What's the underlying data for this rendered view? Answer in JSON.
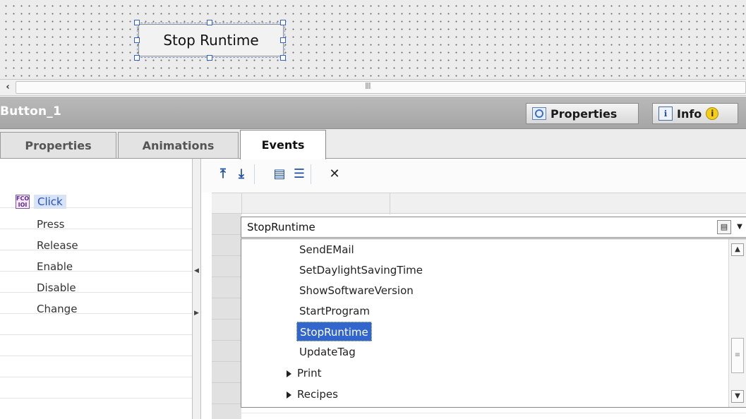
{
  "canvas": {
    "button_label": "Stop Runtime"
  },
  "hscroll": {
    "left_arrow": "‹",
    "grip": "III"
  },
  "inspector": {
    "title": "Button_1",
    "tabs": [
      {
        "label": "Properties",
        "icon": "properties-icon"
      },
      {
        "label": "Info",
        "icon": "info-icon",
        "badge": "i"
      }
    ]
  },
  "subtabs": [
    {
      "label": "Properties",
      "active": false
    },
    {
      "label": "Animations",
      "active": false
    },
    {
      "label": "Events",
      "active": true
    }
  ],
  "events": {
    "selected": "Click",
    "selected_icon_text": "FCO IOI",
    "items": [
      "Press",
      "Release",
      "Enable",
      "Disable",
      "Change"
    ]
  },
  "toolbar": {
    "buttons": [
      {
        "name": "move-up-icon",
        "glyph": "⤒"
      },
      {
        "name": "move-down-icon",
        "glyph": "⤓"
      },
      {
        "name": "expand-icon",
        "glyph": "▤"
      },
      {
        "name": "list-icon",
        "glyph": "☰"
      },
      {
        "name": "delete-icon",
        "glyph": "✕"
      }
    ]
  },
  "function_list": {
    "combo_value": "StopRuntime",
    "combo_icon": "▤",
    "combo_arrow": "▼",
    "items": [
      "SendEMail",
      "SetDaylightSavingTime",
      "ShowSoftwareVersion",
      "StartProgram",
      "StopRuntime",
      "UpdateTag"
    ],
    "selected": "StopRuntime",
    "folders": [
      "Print",
      "Recipes"
    ],
    "scroll_up": "▲",
    "scroll_down": "▼",
    "scroll_grip": "≡"
  },
  "colors": {
    "selection": "#3266cc",
    "header_bg": "#a6a6a6",
    "handle": "#2f62cc"
  }
}
